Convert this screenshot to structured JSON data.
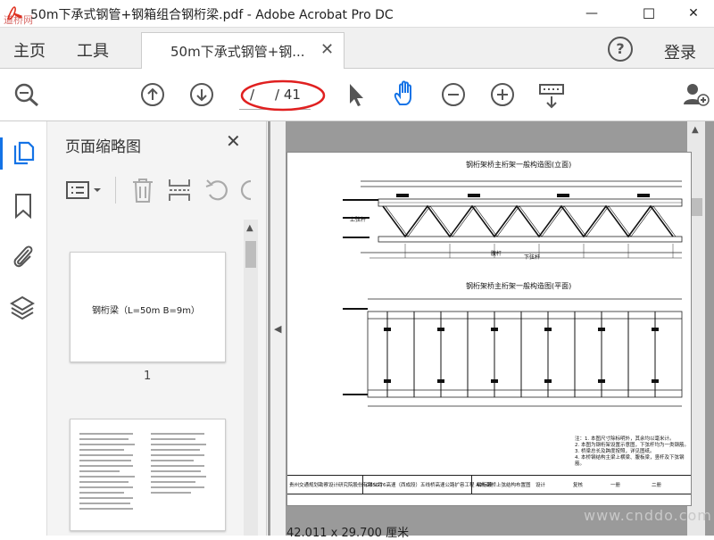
{
  "window": {
    "title": "50m下承式钢管+钢箱组合钢桁梁.pdf - Adobe Acrobat Pro DC",
    "minimize": "—",
    "maximize": "☐",
    "close": "✕",
    "watermark": "道桥网"
  },
  "menu": {
    "home": "主页",
    "tools": "工具",
    "doc_tab": "50m下承式钢管+钢...",
    "doc_tab_close": "✕",
    "help": "?",
    "login": "登录"
  },
  "toolbar": {
    "page_current": "/",
    "page_total": "/ 41"
  },
  "thumbnails": {
    "title": "页面缩略图",
    "close": "✕",
    "page1_text": "钢桁梁（L=50m  B=9m）",
    "page1_num": "1"
  },
  "document": {
    "drawing_title_top": "钢桁架桥主桁架一般构造图(立面)",
    "drawing_title_mid": "钢桁架桥主桁架一般构造图(平面)",
    "label_a": "上弦杆",
    "label_b": "下弦杆",
    "label_c": "腹杆",
    "notes": [
      "注：1. 本图尺寸除标明外，其余均以毫米计。",
      "2. 本图为钢桁架设置示意图，下弦杆均为一类钢筋。",
      "3. 桥梁总长及跨度按照，详见图纸。",
      "4. 本桥钢结构主梁上横梁、腹板梁，竖杆及下弦钢筋。"
    ],
    "footer_org": "贵州交通规划勘察设计研究院股份有限公司",
    "footer_project": "G85G76高速（西成段）五线桥高速公路扩容工程 A2标段",
    "footer_drawing": "钢桁架桥上弦结构布置图",
    "footer_design": "设计",
    "footer_review": "复核",
    "footer_page1": "一册",
    "footer_page2": "二册",
    "page_size": "42.011 x 29.700 厘米",
    "watermark_bottom": "www.cnddo.com"
  },
  "colors": {
    "accent_blue": "#1473e6",
    "highlight_red": "#e02020",
    "acrobat_red": "#e0301e"
  }
}
